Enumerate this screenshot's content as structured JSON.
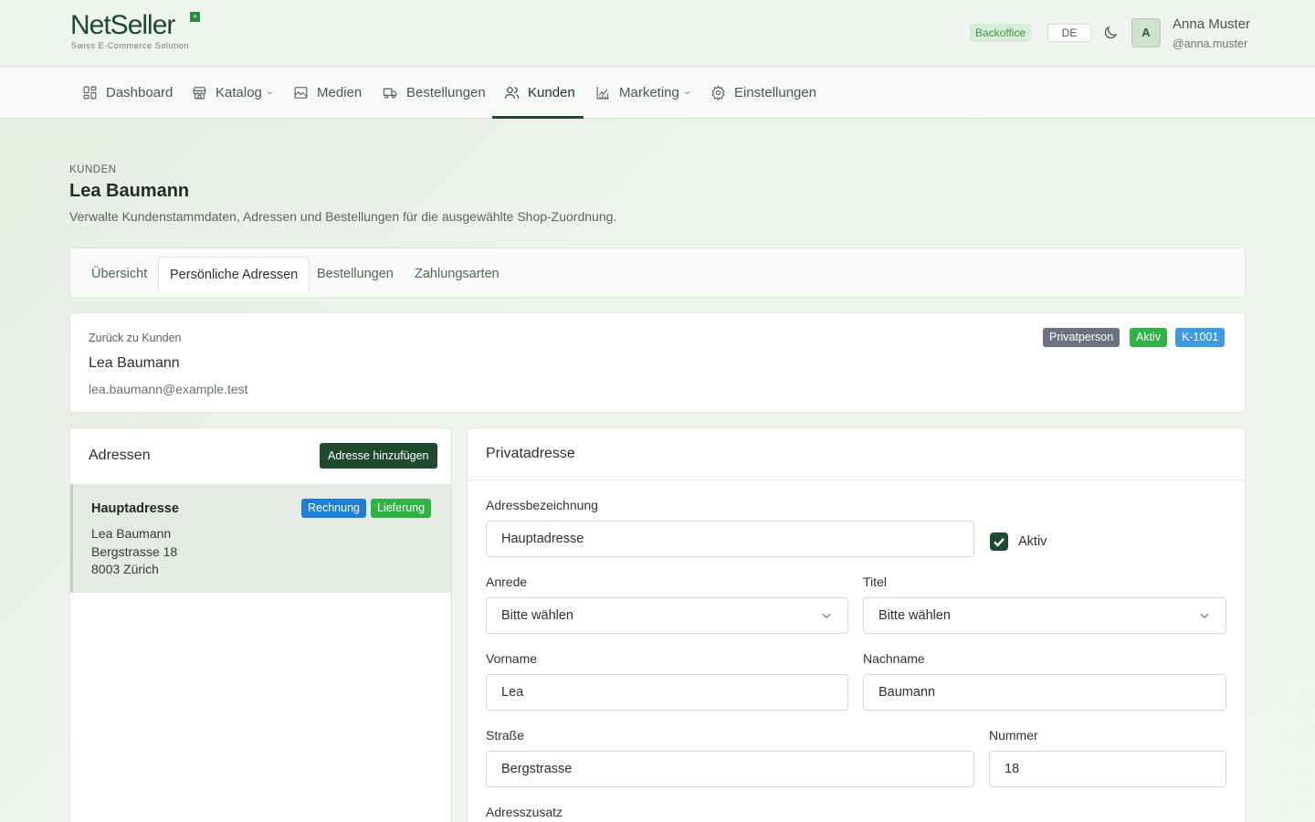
{
  "brand": {
    "name": "NetSeller",
    "tagline": "Swiss E-Commerce Solution",
    "mark": "+"
  },
  "header": {
    "env_badge": "Backoffice",
    "language": "DE",
    "avatar_initial": "A",
    "user_name": "Anna Muster",
    "user_handle": "@anna.muster"
  },
  "nav": {
    "items": [
      {
        "label": "Dashboard",
        "icon": "dashboard-icon"
      },
      {
        "label": "Katalog",
        "icon": "store-icon",
        "dropdown": true
      },
      {
        "label": "Medien",
        "icon": "image-icon"
      },
      {
        "label": "Bestellungen",
        "icon": "truck-icon"
      },
      {
        "label": "Kunden",
        "icon": "users-icon",
        "active": true
      },
      {
        "label": "Marketing",
        "icon": "chart-icon",
        "dropdown": true
      },
      {
        "label": "Einstellungen",
        "icon": "gear-icon"
      }
    ]
  },
  "page": {
    "eyebrow": "KUNDEN",
    "title": "Lea Baumann",
    "description": "Verwalte Kundenstammdaten, Adressen und Bestellungen für die ausgewählte Shop-Zuordnung."
  },
  "tabs": [
    {
      "label": "Übersicht"
    },
    {
      "label": "Persönliche Adressen",
      "active": true
    },
    {
      "label": "Bestellungen"
    },
    {
      "label": "Zahlungsarten"
    }
  ],
  "customer": {
    "back_link": "Zurück zu Kunden",
    "name": "Lea Baumann",
    "email": "lea.baumann@example.test",
    "badges": [
      {
        "label": "Privatperson",
        "color": "#6b7280"
      },
      {
        "label": "Aktiv",
        "color": "#2fb344"
      },
      {
        "label": "K-1001",
        "color": "#3d9ae0"
      }
    ]
  },
  "addresses": {
    "title": "Adressen",
    "add_button": "Adresse hinzufügen",
    "items": [
      {
        "title": "Hauptadresse",
        "badges": [
          {
            "label": "Rechnung",
            "color": "#1e7fd6"
          },
          {
            "label": "Lieferung",
            "color": "#2fb344"
          }
        ],
        "lines": [
          "Lea Baumann",
          "Bergstrasse 18",
          "8003 Zürich"
        ]
      }
    ]
  },
  "form": {
    "title": "Privatadresse",
    "label_name": "Adressbezeichnung",
    "value_name": "Hauptadresse",
    "active_label": "Aktiv",
    "active_checked": true,
    "label_salutation": "Anrede",
    "value_salutation": "Bitte wählen",
    "label_title": "Titel",
    "value_title": "Bitte wählen",
    "label_firstname": "Vorname",
    "value_firstname": "Lea",
    "label_lastname": "Nachname",
    "value_lastname": "Baumann",
    "label_street": "Straße",
    "value_street": "Bergstrasse",
    "label_number": "Nummer",
    "value_number": "18",
    "label_addition": "Adresszusatz"
  },
  "colors": {
    "brand": "#1e4a2e",
    "accent_green": "#2fb344",
    "accent_blue": "#1e7fd6"
  }
}
